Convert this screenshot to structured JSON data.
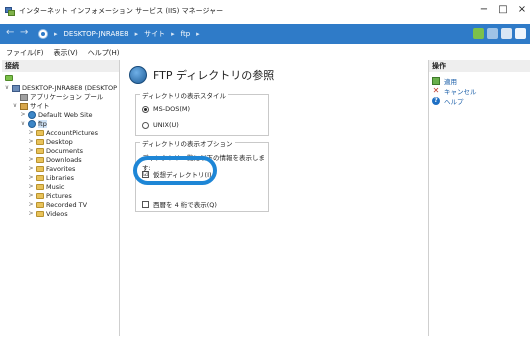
{
  "window": {
    "title": "インターネット インフォメーション サービス (IIS) マネージャー",
    "minimize": "−",
    "maximize": "□",
    "close": "×"
  },
  "address": {
    "back": "←",
    "forward": "→",
    "crumbs": [
      "DESKTOP-JNRA8E8",
      "サイト",
      "ftp"
    ],
    "separator": "▸"
  },
  "menu": {
    "file": "ファイル(F)",
    "view": "表示(V)",
    "help": "ヘルプ(H)"
  },
  "connections": {
    "header": "接続",
    "tree": [
      {
        "label": "DESKTOP-JNRA8E8 (DESKTOP",
        "expander": "∨"
      },
      {
        "label": "アプリケーション プール",
        "expander": ""
      },
      {
        "label": "サイト",
        "expander": "∨"
      },
      {
        "label": "Default Web Site",
        "expander": ">"
      },
      {
        "label": "ftp",
        "expander": "∨"
      },
      {
        "label": "AccountPictures",
        "expander": ">"
      },
      {
        "label": "Desktop",
        "expander": ">"
      },
      {
        "label": "Documents",
        "expander": ">"
      },
      {
        "label": "Downloads",
        "expander": ">"
      },
      {
        "label": "Favorites",
        "expander": ">"
      },
      {
        "label": "Libraries",
        "expander": ">"
      },
      {
        "label": "Music",
        "expander": ">"
      },
      {
        "label": "Pictures",
        "expander": ">"
      },
      {
        "label": "Recorded TV",
        "expander": ">"
      },
      {
        "label": "Videos",
        "expander": ">"
      }
    ]
  },
  "main": {
    "title": "FTP ディレクトリの参照",
    "style_group": {
      "legend": "ディレクトリの表示スタイル",
      "options": [
        "MS-DOS(M)",
        "UNIX(U)"
      ],
      "selected": "MS-DOS(M)"
    },
    "display_group": {
      "legend": "ディレクトリの表示オプション",
      "description": "ディレクトリ一覧に以下の情報を表示します:",
      "virtual_dirs": "仮想ディレクトリ(I)",
      "virtual_dirs_checked": true,
      "check_mark": "☑",
      "four_digit_year": "西暦を 4 桁で表示(Q)",
      "four_digit_year_checked": false
    }
  },
  "actions": {
    "header": "操作",
    "apply": "適用",
    "cancel": "キャンセル",
    "help": "ヘルプ",
    "cancel_glyph": "✕",
    "help_glyph": "?"
  },
  "colors": {
    "addressbar": "#2f7bc8",
    "highlight": "#1e86d6",
    "link": "#1a5ea8"
  }
}
